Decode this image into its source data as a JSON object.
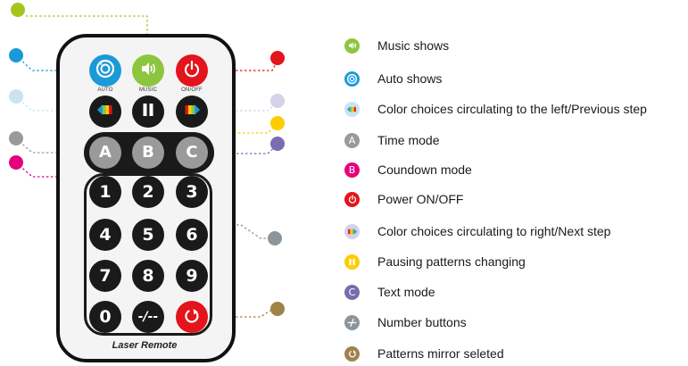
{
  "remote": {
    "brand": "Laser Remote",
    "top_buttons": [
      {
        "caption": "AUTO",
        "icon": "auto-shows-icon",
        "color": "#1a9ad9"
      },
      {
        "caption": "MUSIC",
        "icon": "music-shows-icon",
        "color": "#8cc63f"
      },
      {
        "caption": "ON/OFF",
        "icon": "power-icon",
        "color": "#e3141b"
      }
    ],
    "row2": [
      {
        "icon": "color-left-icon"
      },
      {
        "icon": "pause-icon"
      },
      {
        "icon": "color-right-icon"
      }
    ],
    "mode_buttons": [
      "A",
      "B",
      "C"
    ],
    "number_buttons": [
      "1",
      "2",
      "3",
      "4",
      "5",
      "6",
      "7",
      "8",
      "9",
      "0"
    ],
    "special_buttons": [
      {
        "icon": "number-separator-icon",
        "label": "-/--"
      },
      {
        "icon": "mirror-icon",
        "color": "#e3141b"
      }
    ]
  },
  "callout_colors": {
    "music": "#a5c51c",
    "auto": "#1a9ad9",
    "color_left": "#c8e3f4",
    "time": "#9a9a9a",
    "countdown": "#e5007d",
    "power": "#e3141b",
    "color_right": "#d4d2e8",
    "pause": "#ffcc00",
    "text": "#7a6cb0",
    "number": "#8c959a",
    "mirror": "#a0814a"
  },
  "legend": [
    {
      "label": "Music shows",
      "icon": "music-shows-icon",
      "color": "#8cc63f"
    },
    {
      "label": "Auto shows",
      "icon": "auto-shows-icon",
      "color": "#1a9ad9"
    },
    {
      "label": "Color choices circulating to the left/Previous step",
      "icon": "color-left-icon",
      "color": "#c8e3f4"
    },
    {
      "label": "Time mode",
      "icon": "time-mode-icon",
      "color": "#9a9a9a",
      "glyph": "A"
    },
    {
      "label": "Coundown mode",
      "icon": "countdown-mode-icon",
      "color": "#e5007d",
      "glyph": "B"
    },
    {
      "label": "Power ON/OFF",
      "icon": "power-icon",
      "color": "#e3141b"
    },
    {
      "label": "Color choices circulating to right/Next step",
      "icon": "color-right-icon",
      "color": "#d4d2e8"
    },
    {
      "label": "Pausing patterns changing",
      "icon": "pause-icon",
      "color": "#ffcc00"
    },
    {
      "label": "Text mode",
      "icon": "text-mode-icon",
      "color": "#7a6cb0",
      "glyph": "C"
    },
    {
      "label": "Number buttons",
      "icon": "number-buttons-icon",
      "color": "#8c959a"
    },
    {
      "label": "Patterns mirror seleted",
      "icon": "mirror-icon",
      "color": "#a0814a"
    }
  ]
}
